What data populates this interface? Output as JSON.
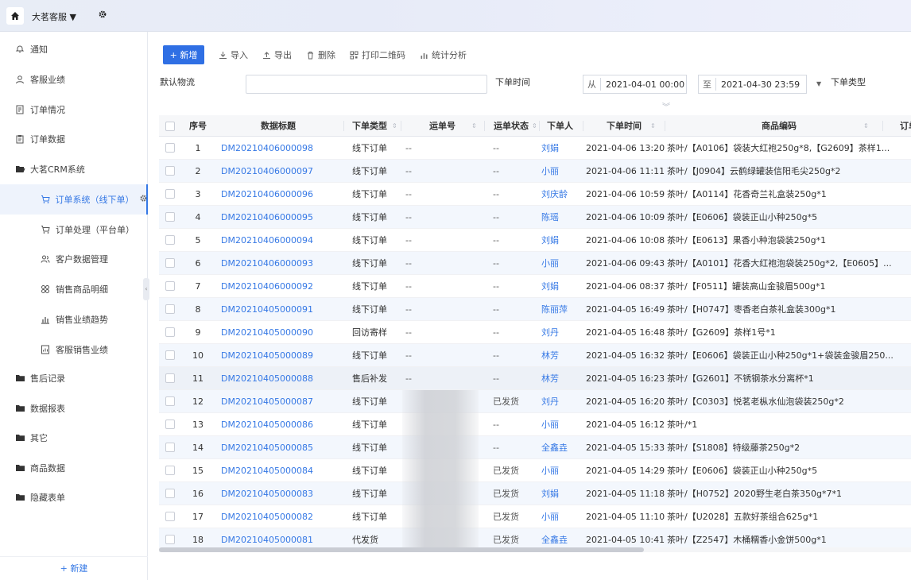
{
  "topbar": {
    "title": "大茗客服 ▼"
  },
  "sidebar": {
    "items": [
      {
        "label": "通知",
        "icon": "bell-icon"
      },
      {
        "label": "客服业绩",
        "icon": "person-icon"
      },
      {
        "label": "订单情况",
        "icon": "doc-icon"
      },
      {
        "label": "订单数据",
        "icon": "clipboard-icon"
      },
      {
        "label": "大茗CRM系统",
        "icon": "folder-open-icon"
      },
      {
        "label": "订单系统（线下单）",
        "icon": "cart-icon"
      },
      {
        "label": "订单处理（平台单）",
        "icon": "cart-icon"
      },
      {
        "label": "客户数据管理",
        "icon": "people-icon"
      },
      {
        "label": "销售商品明细",
        "icon": "grid-icon"
      },
      {
        "label": "销售业绩趋势",
        "icon": "bar-chart-icon"
      },
      {
        "label": "客服销售业绩",
        "icon": "doc-chart-icon"
      },
      {
        "label": "售后记录",
        "icon": "folder-icon"
      },
      {
        "label": "数据报表",
        "icon": "folder-icon"
      },
      {
        "label": "其它",
        "icon": "folder-icon"
      },
      {
        "label": "商品数据",
        "icon": "folder-icon"
      },
      {
        "label": "隐藏表单",
        "icon": "folder-icon"
      }
    ],
    "add_label": "+ 新建"
  },
  "toolbar": {
    "add_label": "+ 新增",
    "import_label": "导入",
    "export_label": "导出",
    "delete_label": "删除",
    "qr_label": "打印二维码",
    "stats_label": "统计分析"
  },
  "filters": {
    "logistics_label": "默认物流",
    "logistics_value": "",
    "order_time_label": "下单时间",
    "from_prefix": "从",
    "from_value": "2021-04-01 00:00",
    "to_prefix": "至",
    "to_value": "2021-04-30 23:59",
    "order_type_label": "下单类型"
  },
  "table": {
    "columns": {
      "seq": "序号",
      "title": "数据标题",
      "type": "下单类型",
      "waybill": "运单号",
      "status": "运单状态",
      "buyer": "下单人",
      "time": "下单时间",
      "goods": "商品编码",
      "extra": "订单"
    },
    "rows": [
      {
        "seq": "1",
        "title": "DM20210406000098",
        "type": "线下订单",
        "waybill": "--",
        "status": "--",
        "buyer": "刘娟",
        "time": "2021-04-06 13:20",
        "goods": "茶叶/【A0106】袋装大红袍250g*8,【G2609】茶样1..."
      },
      {
        "seq": "2",
        "title": "DM20210406000097",
        "type": "线下订单",
        "waybill": "--",
        "status": "--",
        "buyer": "小丽",
        "time": "2021-04-06 11:11",
        "goods": "茶叶/【J0904】云鹤绿罐装信阳毛尖250g*2"
      },
      {
        "seq": "3",
        "title": "DM20210406000096",
        "type": "线下订单",
        "waybill": "--",
        "status": "--",
        "buyer": "刘庆龄",
        "time": "2021-04-06 10:59",
        "goods": "茶叶/【A0114】花香奇兰礼盒装250g*1"
      },
      {
        "seq": "4",
        "title": "DM20210406000095",
        "type": "线下订单",
        "waybill": "--",
        "status": "--",
        "buyer": "陈瑶",
        "time": "2021-04-06 10:09",
        "goods": "茶叶/【E0606】袋装正山小种250g*5"
      },
      {
        "seq": "5",
        "title": "DM20210406000094",
        "type": "线下订单",
        "waybill": "--",
        "status": "--",
        "buyer": "刘娟",
        "time": "2021-04-06 10:08",
        "goods": "茶叶/【E0613】果香小种泡袋装250g*1"
      },
      {
        "seq": "6",
        "title": "DM20210406000093",
        "type": "线下订单",
        "waybill": "--",
        "status": "--",
        "buyer": "小丽",
        "time": "2021-04-06 09:43",
        "goods": "茶叶/【A0101】花香大红袍泡袋装250g*2,【E0605】..."
      },
      {
        "seq": "7",
        "title": "DM20210406000092",
        "type": "线下订单",
        "waybill": "--",
        "status": "--",
        "buyer": "刘娟",
        "time": "2021-04-06 08:37",
        "goods": "茶叶/【F0511】罐装高山金骏眉500g*1"
      },
      {
        "seq": "8",
        "title": "DM20210405000091",
        "type": "线下订单",
        "waybill": "--",
        "status": "--",
        "buyer": "陈丽萍",
        "time": "2021-04-05 16:49",
        "goods": "茶叶/【H0747】枣香老白茶礼盒装300g*1"
      },
      {
        "seq": "9",
        "title": "DM20210405000090",
        "type": "回访寄样",
        "waybill": "--",
        "status": "--",
        "buyer": "刘丹",
        "time": "2021-04-05 16:48",
        "goods": "茶叶/【G2609】茶样1号*1"
      },
      {
        "seq": "10",
        "title": "DM20210405000089",
        "type": "线下订单",
        "waybill": "--",
        "status": "--",
        "buyer": "林芳",
        "time": "2021-04-05 16:32",
        "goods": "茶叶/【E0606】袋装正山小种250g*1+袋装金骏眉250..."
      },
      {
        "seq": "11",
        "title": "DM20210405000088",
        "type": "售后补发",
        "waybill": "--",
        "status": "--",
        "buyer": "林芳",
        "time": "2021-04-05 16:23",
        "goods": "茶叶/【G2601】不锈钢茶水分离杯*1"
      },
      {
        "seq": "12",
        "title": "DM20210405000087",
        "type": "线下订单",
        "waybill": "",
        "status": "已发货",
        "buyer": "刘丹",
        "time": "2021-04-05 16:20",
        "goods": "茶叶/【C0303】悦茗老枞水仙泡袋装250g*2"
      },
      {
        "seq": "13",
        "title": "DM20210405000086",
        "type": "线下订单",
        "waybill": "",
        "status": "--",
        "buyer": "小丽",
        "time": "2021-04-05 16:12",
        "goods": "茶叶/*1"
      },
      {
        "seq": "14",
        "title": "DM20210405000085",
        "type": "线下订单",
        "waybill": "",
        "status": "--",
        "buyer": "全鑫垚",
        "time": "2021-04-05 15:33",
        "goods": "茶叶/【S1808】特级藤茶250g*2"
      },
      {
        "seq": "15",
        "title": "DM20210405000084",
        "type": "线下订单",
        "waybill": "",
        "status": "已发货",
        "buyer": "小丽",
        "time": "2021-04-05 14:29",
        "goods": "茶叶/【E0606】袋装正山小种250g*5"
      },
      {
        "seq": "16",
        "title": "DM20210405000083",
        "type": "线下订单",
        "waybill": "",
        "status": "已发货",
        "buyer": "刘娟",
        "time": "2021-04-05 11:18",
        "goods": "茶叶/【H0752】2020野生老白茶350g*7*1"
      },
      {
        "seq": "17",
        "title": "DM20210405000082",
        "type": "线下订单",
        "waybill": "",
        "status": "已发货",
        "buyer": "小丽",
        "time": "2021-04-05 11:10",
        "goods": "茶叶/【U2028】五款好茶组合625g*1"
      },
      {
        "seq": "18",
        "title": "DM20210405000081",
        "type": "代发货",
        "waybill": "",
        "status": "已发货",
        "buyer": "全鑫垚",
        "time": "2021-04-05 10:41",
        "goods": "茶叶/【Z2547】木桶糯香小金饼500g*1"
      }
    ]
  },
  "colors": {
    "accent": "#3578e5",
    "primary_button": "#2f6fe4"
  }
}
